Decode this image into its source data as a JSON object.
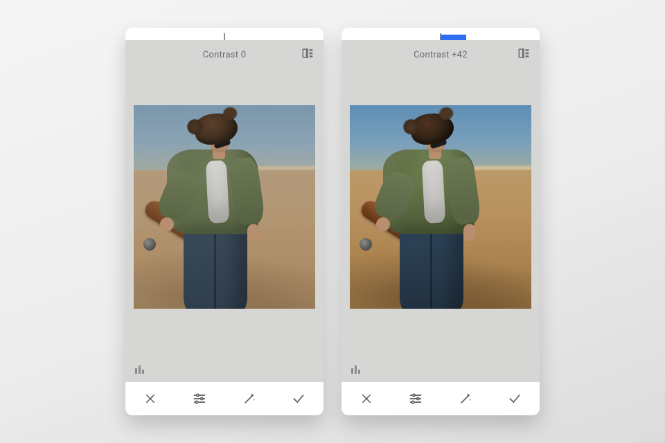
{
  "panels": [
    {
      "contrast_label": "Contrast 0",
      "slider": {
        "center_pct": 50,
        "fill_start_pct": 50,
        "fill_end_pct": 50
      },
      "icons": {
        "compare": "compare-icon",
        "histogram": "histogram-icon"
      },
      "toolbar": {
        "cancel": "✕",
        "tune": "tune",
        "magic": "magic",
        "apply": "✓"
      }
    },
    {
      "contrast_label": "Contrast +42",
      "slider": {
        "center_pct": 50,
        "fill_start_pct": 50,
        "fill_end_pct": 63
      },
      "icons": {
        "compare": "compare-icon",
        "histogram": "histogram-icon"
      },
      "toolbar": {
        "cancel": "✕",
        "tune": "tune",
        "magic": "magic",
        "apply": "✓"
      }
    }
  ]
}
